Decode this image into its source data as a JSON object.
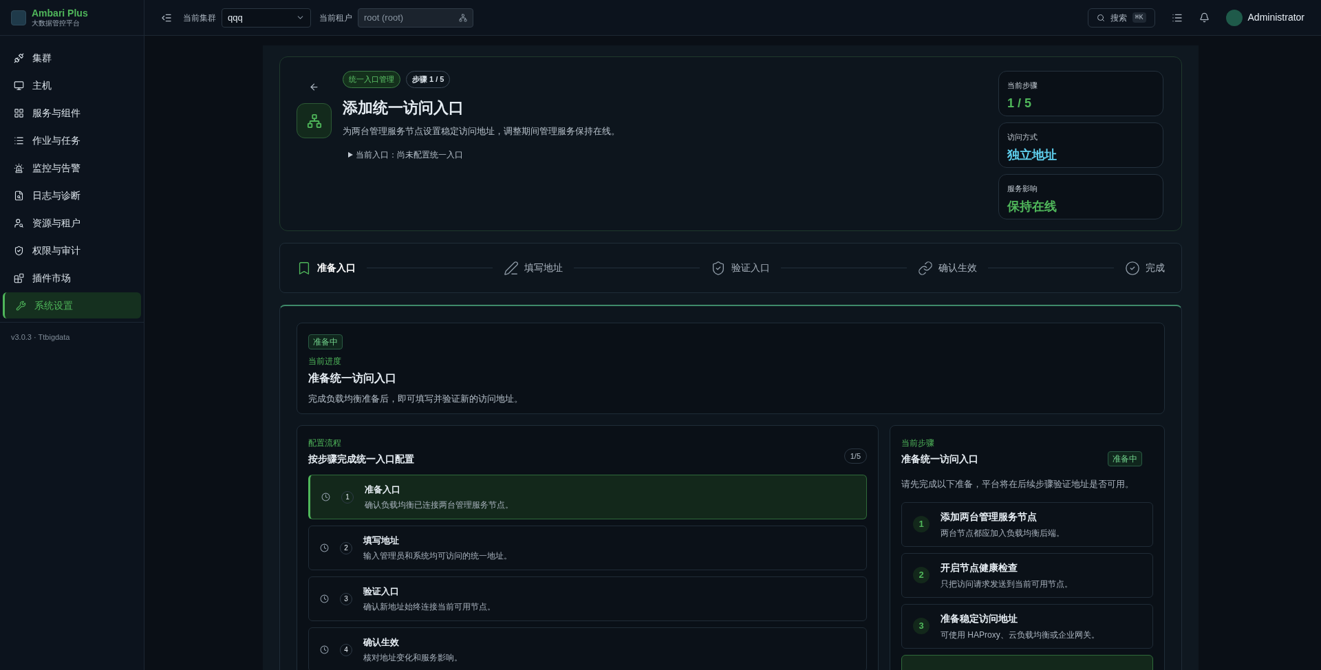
{
  "brand": {
    "title": "Ambari Plus",
    "subtitle": "大数据管控平台"
  },
  "sidebar": {
    "items": [
      {
        "label": "集群",
        "kind": "cluster",
        "selected": false
      },
      {
        "label": "主机",
        "kind": "host",
        "selected": false
      },
      {
        "label": "服务与组件",
        "kind": "service",
        "selected": false
      },
      {
        "label": "作业与任务",
        "kind": "job",
        "selected": false
      },
      {
        "label": "监控与告警",
        "kind": "alert",
        "selected": false
      },
      {
        "label": "日志与诊断",
        "kind": "log",
        "selected": false
      },
      {
        "label": "资源与租户",
        "kind": "tenant",
        "selected": false
      },
      {
        "label": "权限与审计",
        "kind": "audit",
        "selected": false
      },
      {
        "label": "插件市场",
        "kind": "plugin",
        "selected": false
      },
      {
        "label": "系统设置",
        "kind": "settings",
        "selected": true
      }
    ],
    "version": "v3.0.3 · Ttbigdata"
  },
  "topbar": {
    "cluster_label": "当前集群",
    "cluster_value": "qqq",
    "tenant_label": "当前租户",
    "tenant_value": "root (root)",
    "search_label": "搜索",
    "search_shortcut": "⌘K",
    "user": "Administrator"
  },
  "header": {
    "tags": [
      "统一入口管理",
      "步骤 1 / 5"
    ],
    "title": "添加统一访问入口",
    "description": "为两台管理服务节点设置稳定访问地址，调整期间管理服务保持在线。",
    "current_entry": "当前入口：尚未配置统一入口",
    "stats": [
      {
        "label": "当前步骤",
        "value": "1 / 5",
        "color": "#4fb65a"
      },
      {
        "label": "访问方式",
        "value": "独立地址",
        "color": "#5fd0ee"
      },
      {
        "label": "服务影响",
        "value": "保持在线",
        "color": "#4fb65a"
      }
    ]
  },
  "steps": [
    {
      "label": "准备入口",
      "kind": "prepare",
      "selected": true
    },
    {
      "label": "填写地址",
      "kind": "address",
      "selected": false
    },
    {
      "label": "验证入口",
      "kind": "verify",
      "selected": false
    },
    {
      "label": "确认生效",
      "kind": "confirm",
      "selected": false
    },
    {
      "label": "完成",
      "kind": "done",
      "selected": false
    }
  ],
  "progress": {
    "badge": "准备中",
    "eyebrow": "当前进度",
    "title": "准备统一访问入口",
    "description": "完成负载均衡准备后，即可填写并验证新的访问地址。"
  },
  "flow": {
    "eyebrow": "配置流程",
    "title": "按步骤完成统一入口配置",
    "counter": "1/5",
    "items": [
      {
        "number": "1",
        "title": "准备入口",
        "description": "确认负载均衡已连接两台管理服务节点。",
        "selected": true
      },
      {
        "number": "2",
        "title": "填写地址",
        "description": "输入管理员和系统均可访问的统一地址。",
        "selected": false
      },
      {
        "number": "3",
        "title": "验证入口",
        "description": "确认新地址始终连接当前可用节点。",
        "selected": false
      },
      {
        "number": "4",
        "title": "确认生效",
        "description": "核对地址变化和服务影响。",
        "selected": false
      }
    ]
  },
  "current_step": {
    "eyebrow": "当前步骤",
    "title": "准备统一访问入口",
    "badge": "准备中",
    "description": "请先完成以下准备，平台将在后续步骤验证地址是否可用。",
    "items": [
      {
        "number": "1",
        "title": "添加两台管理服务节点",
        "description": "两台节点都应加入负载均衡后端。"
      },
      {
        "number": "2",
        "title": "开启节点健康检查",
        "description": "只把访问请求发送到当前可用节点。"
      },
      {
        "number": "3",
        "title": "准备稳定访问地址",
        "description": "可使用 HAProxy、云负载均衡或企业网关。"
      }
    ]
  }
}
